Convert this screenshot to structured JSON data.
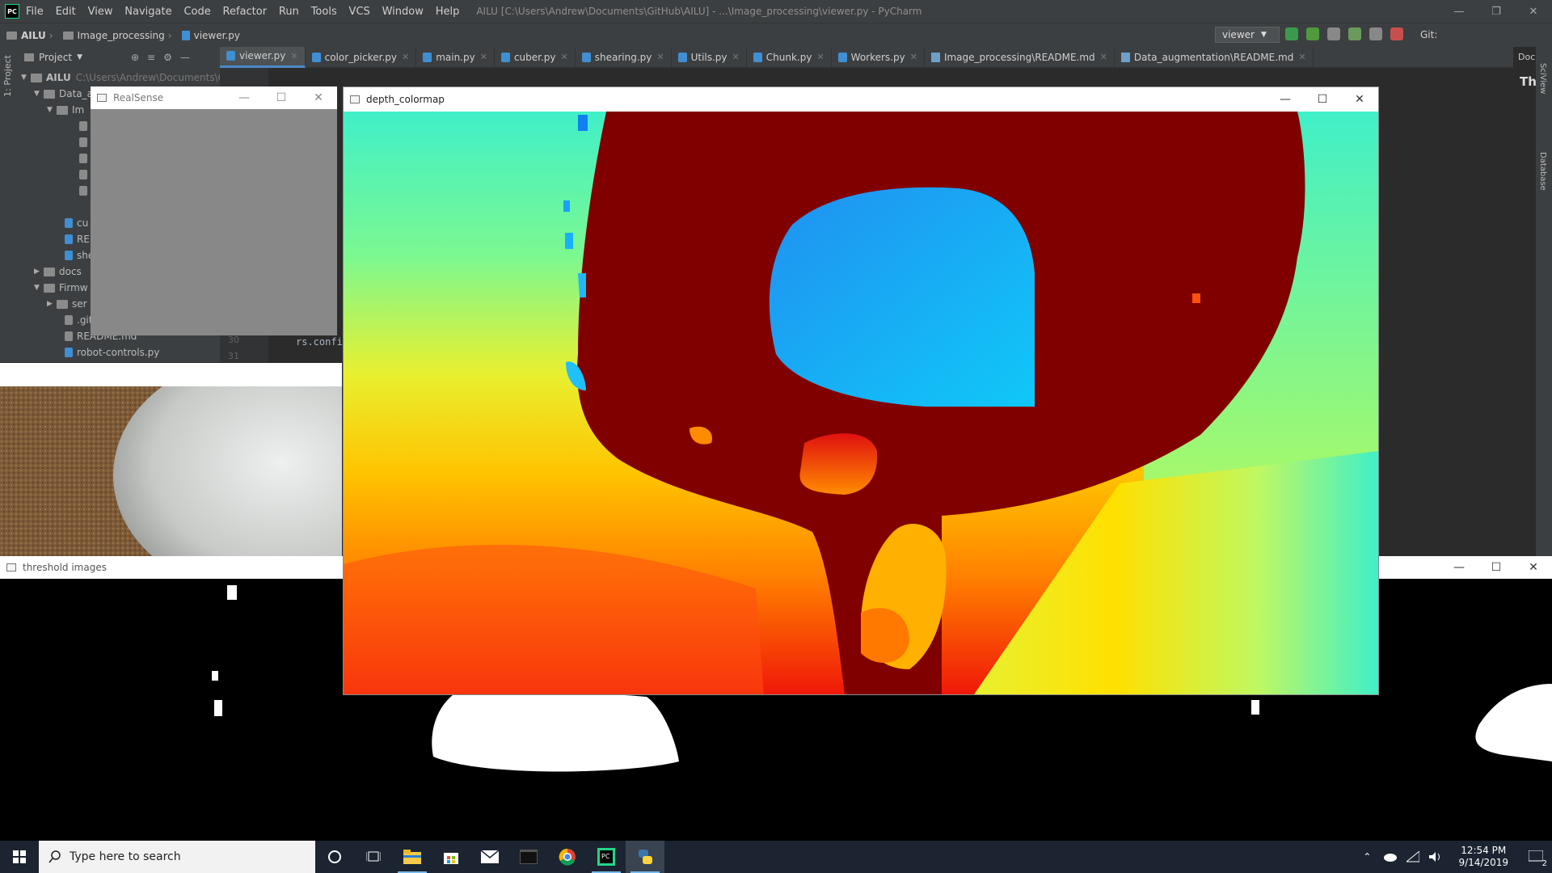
{
  "ide": {
    "logo": "PC",
    "menu": [
      "File",
      "Edit",
      "View",
      "Navigate",
      "Code",
      "Refactor",
      "Run",
      "Tools",
      "VCS",
      "Window",
      "Help"
    ],
    "window_title": "AILU [C:\\Users\\Andrew\\Documents\\GitHub\\AILU] - ...\\Image_processing\\viewer.py - PyCharm",
    "breadcrumbs": [
      "AILU",
      "Image_processing",
      "viewer.py"
    ],
    "run_config": "viewer",
    "git_label": "Git:",
    "project_label": "Project",
    "side_label": "1: Project",
    "tabs": [
      {
        "label": "viewer.py",
        "active": true
      },
      {
        "label": "color_picker.py"
      },
      {
        "label": "main.py"
      },
      {
        "label": "cuber.py"
      },
      {
        "label": "shearing.py"
      },
      {
        "label": "Utils.py"
      },
      {
        "label": "Chunk.py"
      },
      {
        "label": "Workers.py"
      },
      {
        "label": "Image_processing\\README.md"
      },
      {
        "label": "Data_augmentation\\README.md"
      }
    ],
    "tree": [
      {
        "label": "AILU",
        "path": "C:\\Users\\Andrew\\Documents\\Gi",
        "type": "folder",
        "open": true
      },
      {
        "label": "Data_a",
        "type": "folder",
        "open": true
      },
      {
        "label": "Im",
        "type": "folder",
        "open": true
      },
      {
        "label": "cu",
        "type": "py"
      },
      {
        "label": "RE",
        "type": "py"
      },
      {
        "label": "she",
        "type": "py"
      },
      {
        "label": "docs",
        "type": "folder",
        "open": false
      },
      {
        "label": "Firmw",
        "type": "folder",
        "open": true
      },
      {
        "label": "ser",
        "type": "folder",
        "open": false
      },
      {
        "label": ".git",
        "type": "file"
      },
      {
        "label": "README.md",
        "type": "file"
      },
      {
        "label": "robot-controls.py",
        "type": "py"
      }
    ],
    "line_numbers": [
      "30",
      "31"
    ],
    "code_snippet": "rs.confi",
    "doc_panel_title": "Doc",
    "doc_heading": "The",
    "right_tabs": [
      "SciView",
      "Database"
    ]
  },
  "windows": {
    "realsense": {
      "title": "RealSense"
    },
    "depth": {
      "title": "depth_colormap"
    },
    "threshold": {
      "title": "threshold images"
    }
  },
  "taskbar": {
    "search_placeholder": "Type here to search",
    "time": "12:54 PM",
    "date": "9/14/2019",
    "notifications": "2"
  },
  "colors": {
    "ide_bg": "#2b2b2b",
    "ide_panel": "#3c3f41",
    "accent": "#4a88c7",
    "taskbar": "#1b2430",
    "depth_near": "#800000",
    "depth_far": "#40f0c0"
  }
}
